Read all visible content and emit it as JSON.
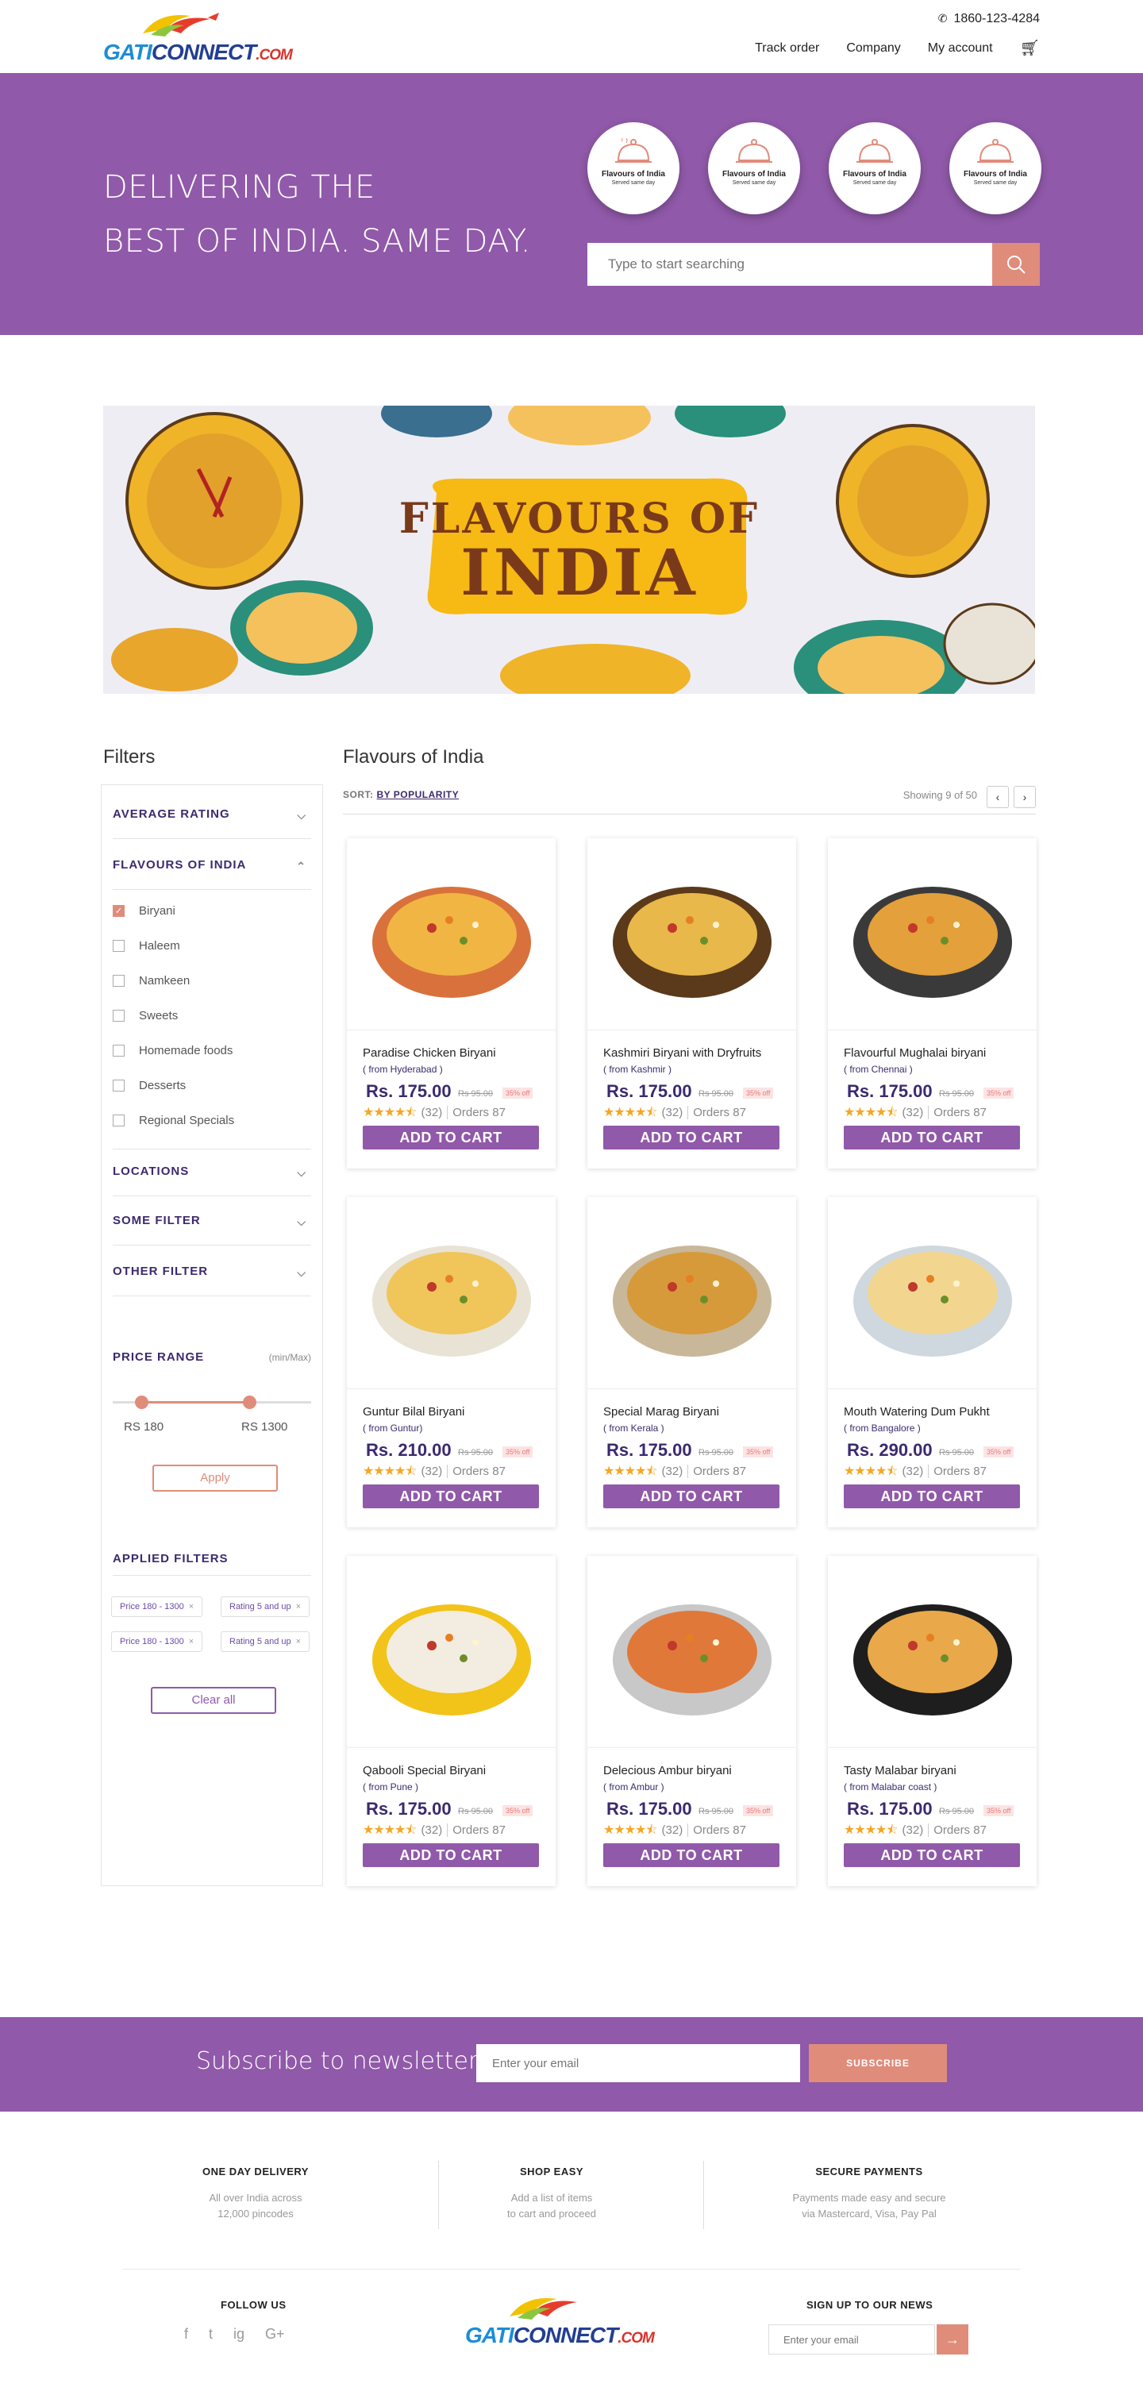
{
  "brand": {
    "logo_text_1": "GATI",
    "logo_text_2": "CONNECT",
    ".com": ".COM",
    "logo_suffix": ".COM"
  },
  "header": {
    "phone": "1860-123-4284",
    "nav": [
      "Track order",
      "Company",
      "My account"
    ]
  },
  "hero": {
    "line1": "DELIVERING THE",
    "line2": "BEST OF INDIA. SAME DAY.",
    "circles": [
      {
        "title": "Flavours of India",
        "subtitle": "Served same day"
      },
      {
        "title": "Flavours of India",
        "subtitle": "Served same day"
      },
      {
        "title": "Flavours of India",
        "subtitle": "Served same day"
      },
      {
        "title": "Flavours of India",
        "subtitle": "Served same day"
      }
    ],
    "search_placeholder": "Type to start searching"
  },
  "banner": {
    "line1": "FLAVOURS OF",
    "line2": "INDIA"
  },
  "filters": {
    "title": "Filters",
    "sections": {
      "avg_rating": "AVERAGE RATING",
      "flavours": "FLAVOURS OF INDIA",
      "locations": "LOCATIONS",
      "some": "SOME FILTER",
      "other": "OTHER FILTER",
      "price": "PRICE RANGE",
      "price_hint": "(min/Max)",
      "applied": "APPLIED FILTERS"
    },
    "flavour_items": [
      {
        "label": "Biryani",
        "checked": true
      },
      {
        "label": "Haleem",
        "checked": false
      },
      {
        "label": "Namkeen",
        "checked": false
      },
      {
        "label": "Sweets",
        "checked": false
      },
      {
        "label": "Homemade foods",
        "checked": false
      },
      {
        "label": "Desserts",
        "checked": false
      },
      {
        "label": "Regional Specials",
        "checked": false
      }
    ],
    "price_min": "RS 180",
    "price_max": "RS 1300",
    "apply": "Apply",
    "chips": [
      "Price 180 - 1300",
      "Rating 5 and up",
      "Price 180 - 1300",
      "Rating 5 and up"
    ],
    "clear": "Clear all"
  },
  "main": {
    "title": "Flavours of India",
    "sort_label": "SORT:",
    "sort_value": "BY POPULARITY",
    "showing": "Showing 9 of 50",
    "prev": "‹",
    "next": "›"
  },
  "products": [
    {
      "name": "Paradise Chicken Biryani",
      "from": "( from Hyderabad )",
      "price": "Rs. 175.00",
      "old": "Rs 95.00",
      "off": "35% off",
      "reviews": "(32)",
      "orders": "Orders 87",
      "add": "ADD TO CART",
      "dish": "pot"
    },
    {
      "name": "Kashmiri Biryani with Dryfruits",
      "from": "( from Kashmir )",
      "price": "Rs. 175.00",
      "old": "Rs 95.00",
      "off": "35% off",
      "reviews": "(32)",
      "orders": "Orders 87",
      "add": "ADD TO CART",
      "dish": "bowl-dark"
    },
    {
      "name": "Flavourful Mughalai biryani",
      "from": "( from Chennai )",
      "price": "Rs. 175.00",
      "old": "Rs 95.00",
      "off": "35% off",
      "reviews": "(32)",
      "orders": "Orders 87",
      "add": "ADD TO CART",
      "dish": "plate-square"
    },
    {
      "name": "Guntur Bilal Biryani",
      "from": "( from Guntur)",
      "price": "Rs. 210.00",
      "old": "Rs 95.00",
      "off": "35% off",
      "reviews": "(32)",
      "orders": "Orders 87",
      "add": "ADD TO CART",
      "dish": "bowl-white"
    },
    {
      "name": "Special Marag Biryani",
      "from": "( from Kerala )",
      "price": "Rs. 175.00",
      "old": "Rs 95.00",
      "off": "35% off",
      "reviews": "(32)",
      "orders": "Orders 87",
      "add": "ADD TO CART",
      "dish": "plate-oval"
    },
    {
      "name": "Mouth Watering Dum Pukht",
      "from": "( from Bangalore )",
      "price": "Rs. 290.00",
      "old": "Rs 95.00",
      "off": "35% off",
      "reviews": "(32)",
      "orders": "Orders 87",
      "add": "ADD TO CART",
      "dish": "plate-glass"
    },
    {
      "name": "Qabooli Special Biryani",
      "from": "( from Pune )",
      "price": "Rs. 175.00",
      "old": "Rs 95.00",
      "off": "35% off",
      "reviews": "(32)",
      "orders": "Orders 87",
      "add": "ADD TO CART",
      "dish": "plate-yellow"
    },
    {
      "name": "Delecious Ambur biryani",
      "from": "( from Ambur )",
      "price": "Rs. 175.00",
      "old": "Rs 95.00",
      "off": "35% off",
      "reviews": "(32)",
      "orders": "Orders 87",
      "add": "ADD TO CART",
      "dish": "plate-steel"
    },
    {
      "name": "Tasty Malabar biryani",
      "from": "( from Malabar coast )",
      "price": "Rs. 175.00",
      "old": "Rs 95.00",
      "off": "35% off",
      "reviews": "(32)",
      "orders": "Orders 87",
      "add": "ADD TO CART",
      "dish": "bowl-black"
    }
  ],
  "rating_stars": 4.5,
  "newsletter": {
    "label": "Subscribe to newsletter",
    "placeholder": "Enter your email",
    "button": "SUBSCRIBE"
  },
  "footer": {
    "features": [
      {
        "title": "ONE DAY DELIVERY",
        "l1": "All over India across",
        "l2": "12,000 pincodes"
      },
      {
        "title": "SHOP EASY",
        "l1": "Add a list of items",
        "l2": "to cart and proceed"
      },
      {
        "title": "SECURE PAYMENTS",
        "l1": "Payments made easy and secure",
        "l2": "via Mastercard, Visa, Pay Pal"
      }
    ],
    "follow": "FOLLOW US",
    "social": [
      "f",
      "t",
      "ig",
      "G+"
    ],
    "signup": "SIGN UP TO OUR NEWS",
    "email_placeholder": "Enter your email",
    "go": "→"
  },
  "colors": {
    "purple": "#9059a9",
    "accent": "#e08c7b",
    "dark_purple": "#3b2a6e",
    "star": "#f5a623"
  }
}
